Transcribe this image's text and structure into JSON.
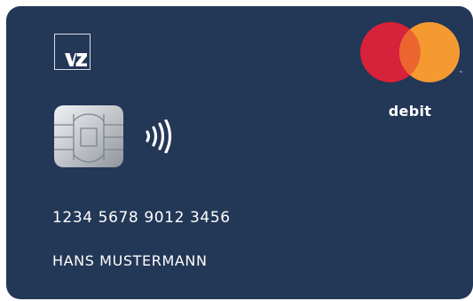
{
  "card": {
    "bank_logo_text": "VZ",
    "card_number": "1234 5678 9012 3456",
    "cardholder_name": "HANS MUSTERMANN",
    "card_type": "debit",
    "network_trademark": "™",
    "network": "mastercard-logo",
    "chip_icon": "emv-chip-icon",
    "contactless_icon": "contactless-icon"
  },
  "colors": {
    "card_background": "#233756",
    "mastercard_red": "#d8213a",
    "mastercard_orange": "#f59a31",
    "mastercard_overlap": "#ec6530",
    "text": "#ffffff"
  }
}
